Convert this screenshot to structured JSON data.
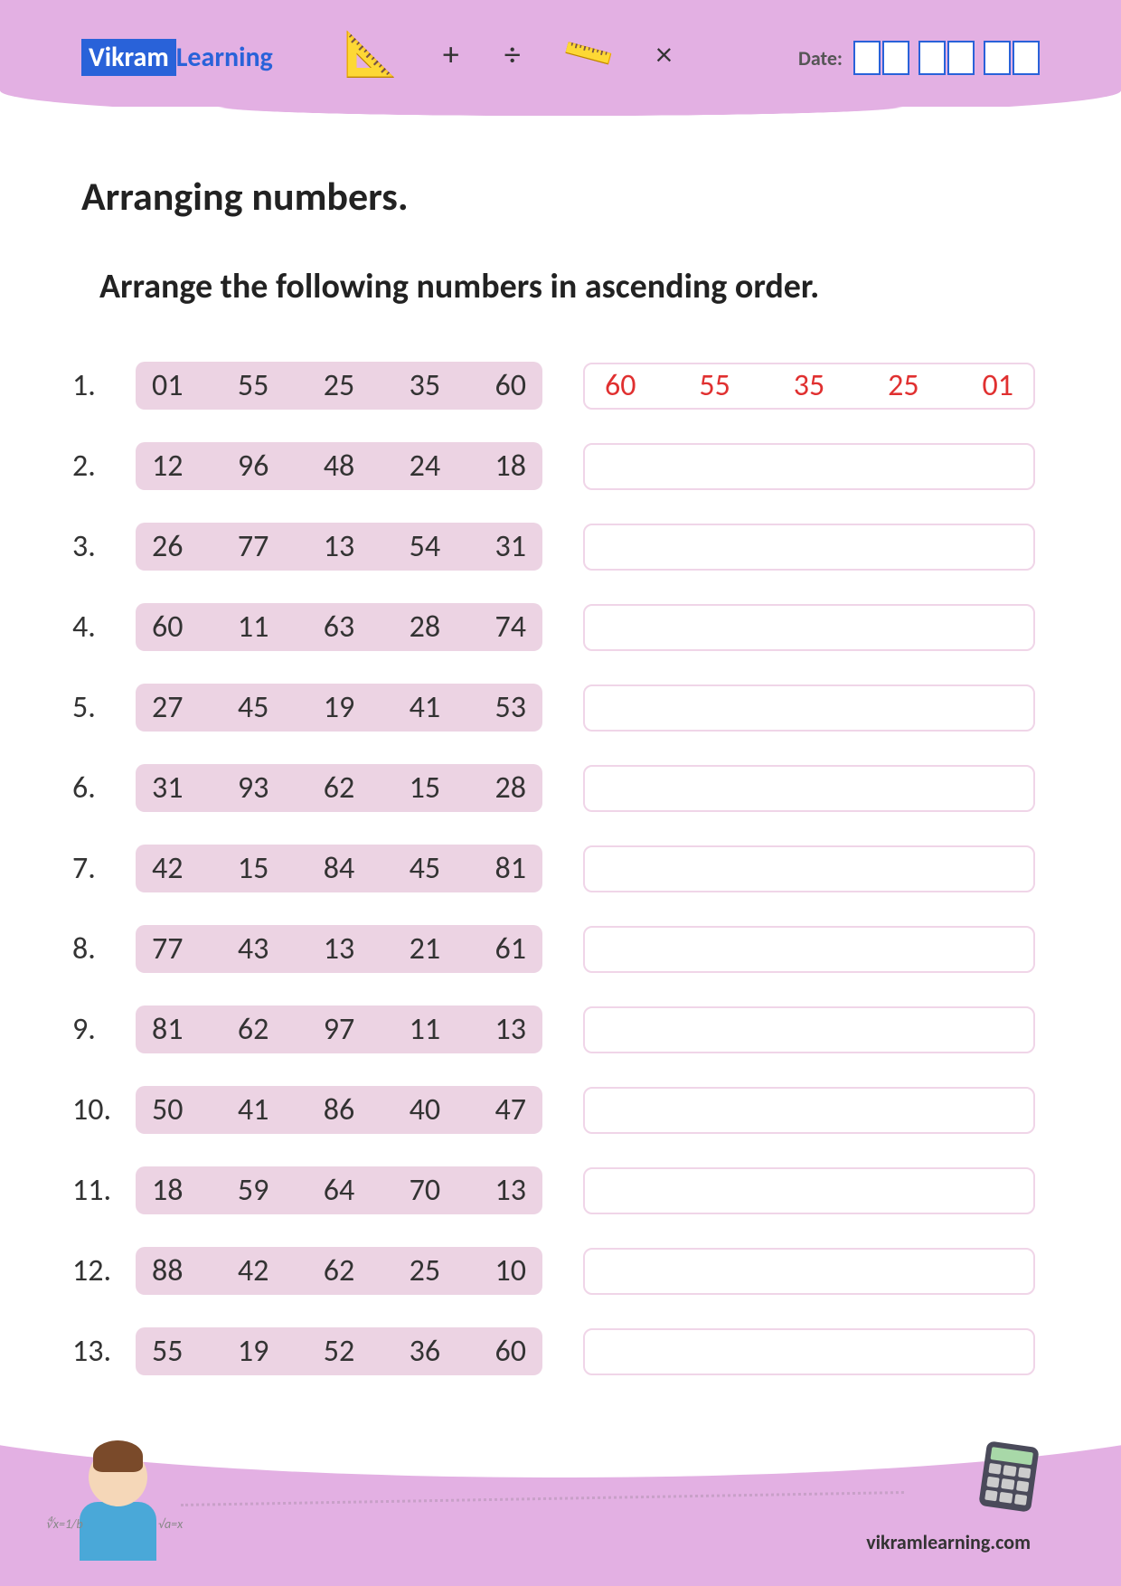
{
  "logo": {
    "part1": "Vikram",
    "part2": "Learning"
  },
  "header_symbols": {
    "plus": "+",
    "divide": "÷",
    "times": "×"
  },
  "date_label": "Date:",
  "title": "Arranging numbers.",
  "instruction": "Arrange the following numbers in ascending order.",
  "problems": [
    {
      "label": "1.",
      "nums": [
        "01",
        "55",
        "25",
        "35",
        "60"
      ],
      "answer": [
        "60",
        "55",
        "35",
        "25",
        "01"
      ]
    },
    {
      "label": "2.",
      "nums": [
        "12",
        "96",
        "48",
        "24",
        "18"
      ],
      "answer": null
    },
    {
      "label": "3.",
      "nums": [
        "26",
        "77",
        "13",
        "54",
        "31"
      ],
      "answer": null
    },
    {
      "label": "4.",
      "nums": [
        "60",
        "11",
        "63",
        "28",
        "74"
      ],
      "answer": null
    },
    {
      "label": "5.",
      "nums": [
        "27",
        "45",
        "19",
        "41",
        "53"
      ],
      "answer": null
    },
    {
      "label": "6.",
      "nums": [
        "31",
        "93",
        "62",
        "15",
        "28"
      ],
      "answer": null
    },
    {
      "label": "7.",
      "nums": [
        "42",
        "15",
        "84",
        "45",
        "81"
      ],
      "answer": null
    },
    {
      "label": "8.",
      "nums": [
        "77",
        "43",
        "13",
        "21",
        "61"
      ],
      "answer": null
    },
    {
      "label": "9.",
      "nums": [
        "81",
        "62",
        "97",
        "11",
        "13"
      ],
      "answer": null
    },
    {
      "label": "10.",
      "nums": [
        "50",
        "41",
        "86",
        "40",
        "47"
      ],
      "answer": null
    },
    {
      "label": "11.",
      "nums": [
        "18",
        "59",
        "64",
        "70",
        "13"
      ],
      "answer": null
    },
    {
      "label": "12.",
      "nums": [
        "88",
        "42",
        "62",
        "25",
        "10"
      ],
      "answer": null
    },
    {
      "label": "13.",
      "nums": [
        "55",
        "19",
        "52",
        "36",
        "60"
      ],
      "answer": null
    }
  ],
  "footer_url": "vikramlearning.com"
}
